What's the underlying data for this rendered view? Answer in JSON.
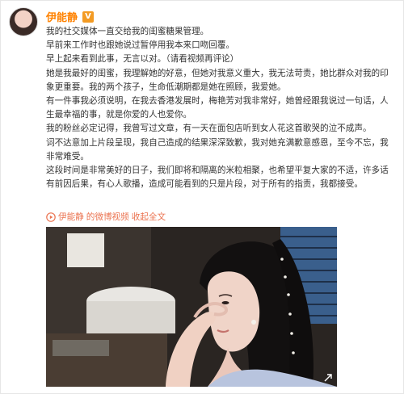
{
  "user": {
    "name": "伊能静"
  },
  "post": {
    "paragraphs": [
      "我的社交媒体一直交给我的闺蜜糖果管理。",
      "早前来工作时也跟她说过暂停用我本来口吻回覆。",
      "早上起来看到此事，无言以对。（请看视频再评论）",
      "她是我最好的闺蜜，我理解她的好意，但她对我意义重大，我无法苛责，她比群众对我的印象更重要。我的两个孩子，生命低潮期都是她在照顾，我爱她。",
      "有一件事我必须说明，在我去香港发展时，梅艳芳对我非常好，她曾经跟我说过一句话，人生最幸福的事，就是你爱的人也爱你。",
      "我的粉丝必定记得，我曾写过文章，有一天在面包店听到女人花这首歌哭的泣不成声。",
      "词不达意加上片段呈现，我自己造成的结果深深致歉，我对她充满歉意感恩，至今不忘，我非常难受。",
      "这段时间是非常美好的日子，我们即将和隔离的米粒相聚，也希望平复大家的不适，许多话有前因后果，有心人歌播，造成可能看到的只是片段，对于所有的指责，我都接受。"
    ]
  },
  "video_link": {
    "author": "伊能静",
    "source_label": "的微博视频",
    "collapse_label": "收起全文",
    "prefix_icon": "play-video-icon"
  },
  "media": {
    "type": "video-still",
    "corner_icon": "expand-icon"
  },
  "colors": {
    "username": "#ff8200",
    "link": "#eb7350",
    "vip_badge": "#f39b24",
    "text": "#333333"
  }
}
